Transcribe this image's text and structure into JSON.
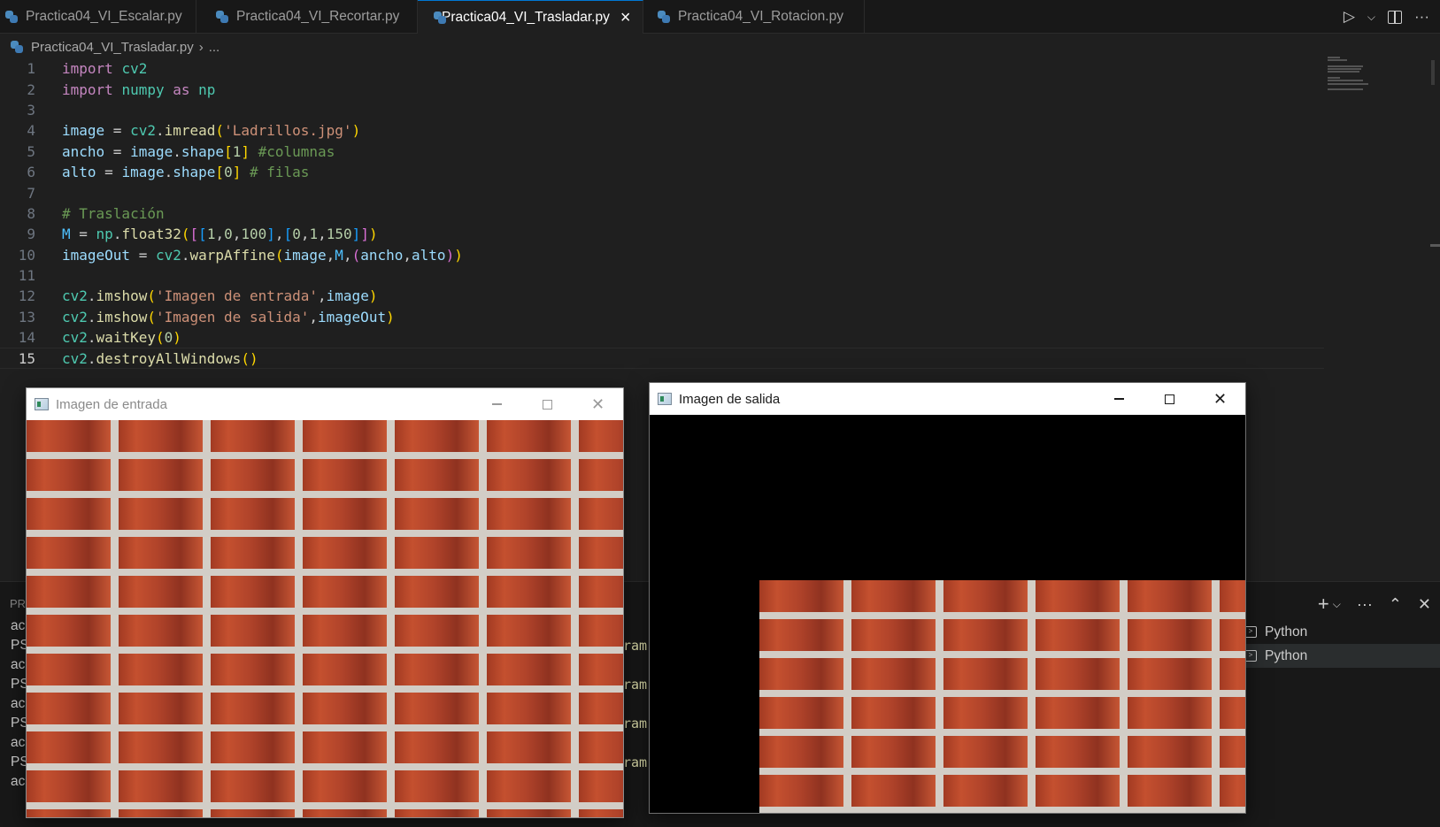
{
  "tabs": [
    {
      "label": "Practica04_VI_Escalar.py",
      "active": false
    },
    {
      "label": "Practica04_VI_Recortar.py",
      "active": false
    },
    {
      "label": "Practica04_VI_Trasladar.py",
      "active": true
    },
    {
      "label": "Practica04_VI_Rotacion.py",
      "active": false
    }
  ],
  "breadcrumb": {
    "file": "Practica04_VI_Trasladar.py",
    "more": "..."
  },
  "editor": {
    "current_line": 15
  },
  "panel": {
    "title_fragment": "PR",
    "terminal_fragments": [
      "ac",
      "PS",
      "ac",
      "PS",
      "ac",
      "PS",
      "ac",
      "PS",
      "ac"
    ],
    "ram_fragments": [
      "ram",
      "ram",
      "ram",
      "ram"
    ],
    "terminals": [
      {
        "label": "Python",
        "selected": false
      },
      {
        "label": "Python",
        "selected": true
      }
    ]
  },
  "windows": {
    "input": {
      "title": "Imagen de entrada"
    },
    "output": {
      "title": "Imagen de salida"
    }
  },
  "icons": {
    "run": "run-icon",
    "split": "split-editor-icon",
    "more": "ellipsis-icon",
    "python_file": "python-file-icon",
    "add_terminal": "plus-icon",
    "maximize_panel": "chevron-up-icon",
    "close_panel": "close-icon"
  },
  "colors": {
    "accent": "#0078d4",
    "editor_bg": "#1f1f1f",
    "brick": "#b0432a",
    "mortar": "#d7d3cd"
  }
}
